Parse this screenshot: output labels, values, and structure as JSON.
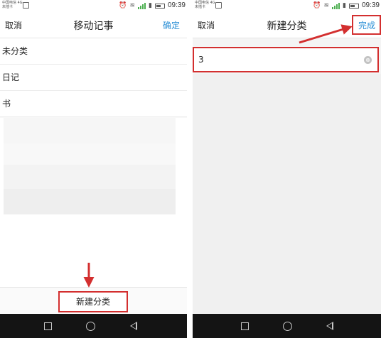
{
  "left_screen": {
    "status": {
      "carrier": "中国电信 4G\n未插卡",
      "time": "09:39"
    },
    "nav": {
      "cancel": "取消",
      "title": "移动记事",
      "confirm": "确定"
    },
    "categories": [
      "未分类",
      "日记",
      "书"
    ],
    "bottom_button": "新建分类"
  },
  "right_screen": {
    "status": {
      "carrier": "中国电信 4G\n未插卡",
      "time": "09:39"
    },
    "nav": {
      "cancel": "取消",
      "title": "新建分类",
      "done": "完成"
    },
    "input_value": "3",
    "clear_icon": "⊗"
  },
  "colors": {
    "accent": "#2a8fd6",
    "highlight": "#d32f2f",
    "system_nav": "#141414"
  },
  "icons": [
    "image-icon",
    "alarm-icon",
    "wifi-icon",
    "signal-icon",
    "sim-icon",
    "battery-icon",
    "square-nav-icon",
    "circle-home-icon",
    "triangle-back-icon",
    "clear-input-icon",
    "arrow-annotation"
  ]
}
